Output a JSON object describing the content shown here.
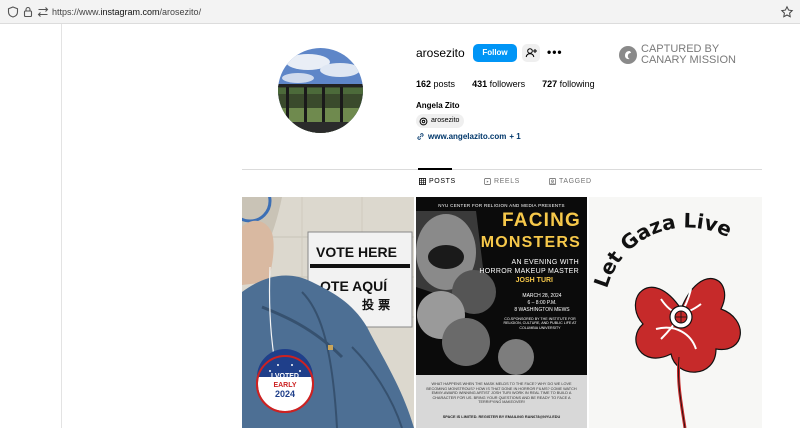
{
  "browser": {
    "url_prefix": "https://www.",
    "url_domain": "instagram.com",
    "url_path": "/arosezito/"
  },
  "profile": {
    "username": "arosezito",
    "follow_label": "Follow",
    "more_label": "•••",
    "stats": {
      "posts_count": "162",
      "posts_label": "posts",
      "followers_count": "431",
      "followers_label": "followers",
      "following_count": "727",
      "following_label": "following"
    },
    "full_name": "Angela Zito",
    "threads_handle": "arosezito",
    "link_text": "www.angelazito.com",
    "link_extra": "+ 1"
  },
  "watermark": {
    "line1": "CAPTURED BY",
    "line2": "CANARY MISSION"
  },
  "tabs": [
    {
      "label": "POSTS",
      "icon": "grid-icon"
    },
    {
      "label": "REELS",
      "icon": "reels-icon"
    },
    {
      "label": "TAGGED",
      "icon": "tagged-icon"
    }
  ],
  "posts": {
    "p1": {
      "sign1": "VOTE HERE",
      "sign2": "OTE AQUÍ",
      "sign3": "投 票",
      "badge1": "I VOTED",
      "badge2": "EARLY",
      "badge3": "2024"
    },
    "p2": {
      "top": "NYU CENTER FOR RELIGION AND MEDIA PRESENTS",
      "title1": "FACING",
      "title2": "MONSTERS",
      "line1": "AN EVENING WITH",
      "line2": "HORROR MAKEUP MASTER",
      "line3": "JOSH TURI",
      "date": "MARCH 28, 2024",
      "time": "6 – 8:00 P.M.",
      "place": "8 WASHINGTON MEWS",
      "cosponsor": "CO-SPONSORED BY THE INSTITUTE FOR RELIGION, CULTURE, AND PUBLIC LIFE AT COLUMBIA UNIVERSITY",
      "blurb": "WHAT HAPPENS WHEN THE MASK MELDS TO THE FACE? WHY DO WE LOVE BECOMING MONSTROUS? HOW IS THAT DONE IN HORROR FILMS? COME WATCH EMMY-AWARD WINNING ARTIST JOSH TURI WORK IN REAL TIME TO BUILD A CHARACTER FOR US. BRING YOUR QUESTIONS AND BE READY TO FACE A TERRIFYING MAKEOVER!",
      "footer": "SPACE IS LIMITED. REGISTER BY EMAILING RAN678@NYU.EDU"
    },
    "p3": {
      "text": "Let Gaza Live"
    }
  }
}
